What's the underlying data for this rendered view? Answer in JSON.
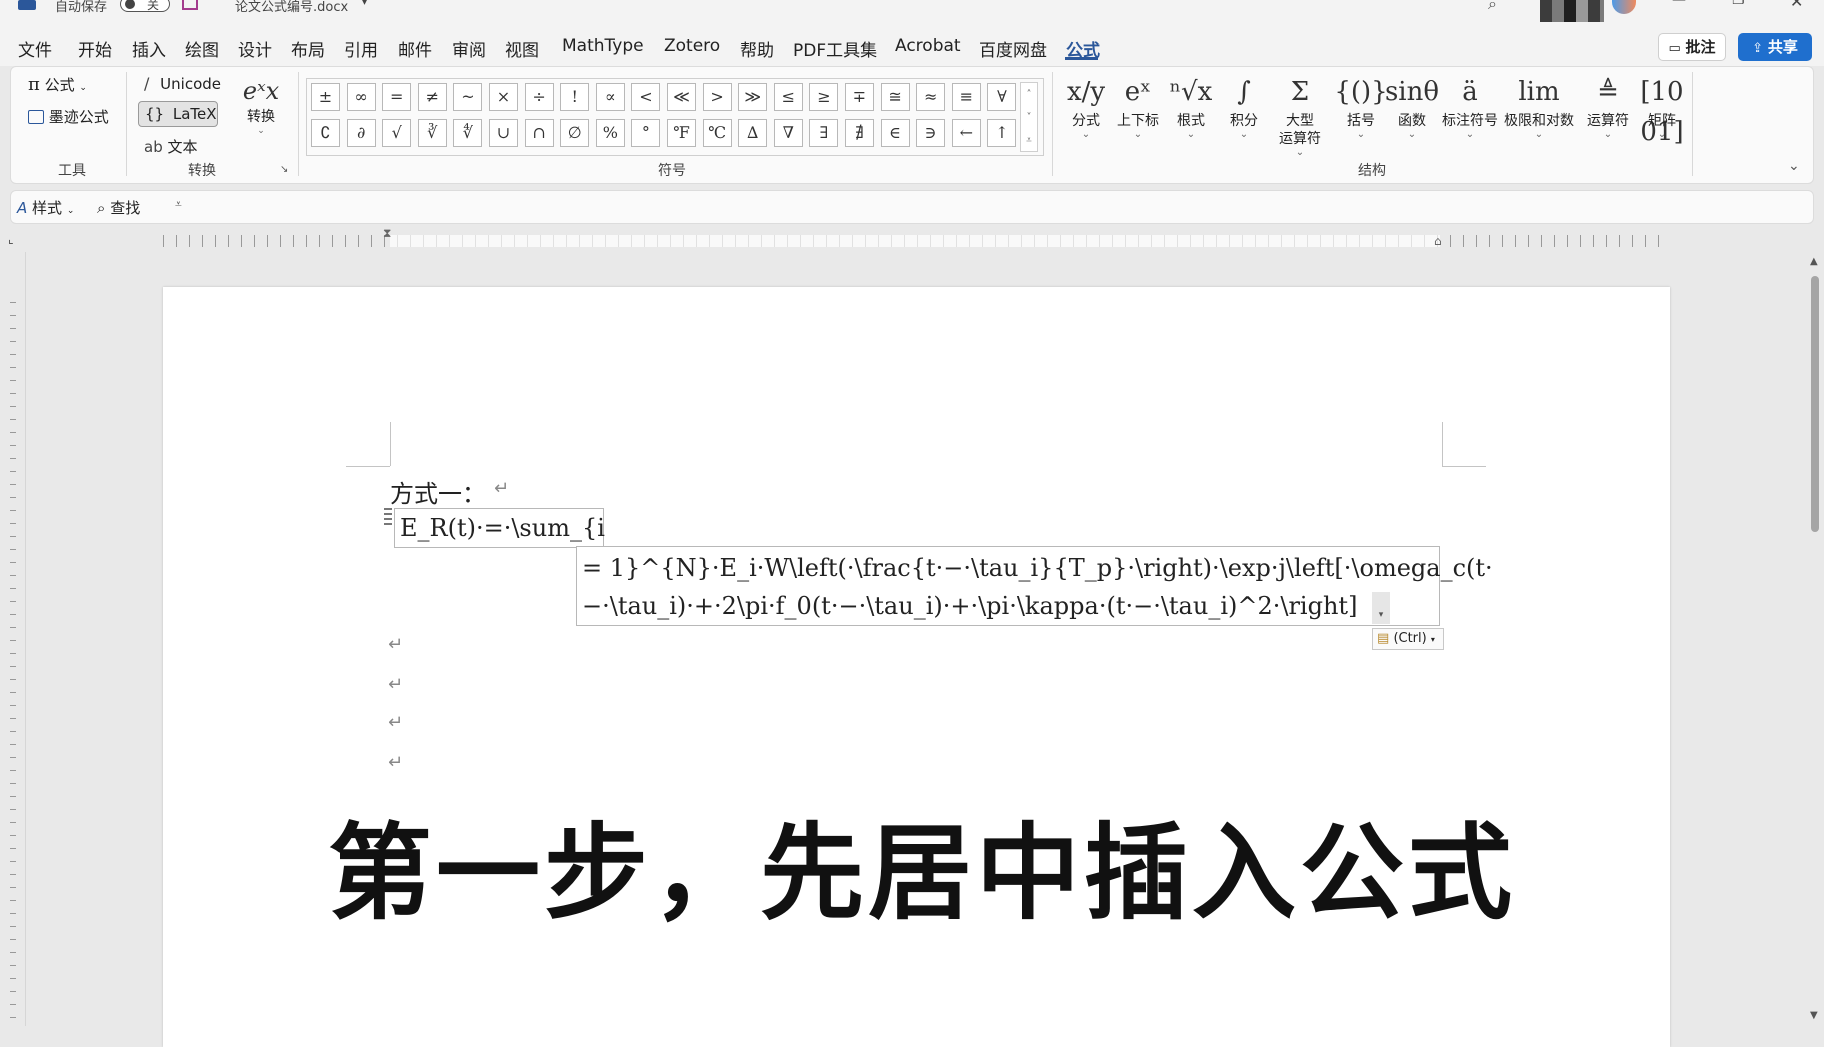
{
  "titlebar": {
    "autosave_label": "自动保存",
    "autosave_state": "关",
    "doc_title": "论文公式编号.docx"
  },
  "menu": {
    "items": [
      "文件",
      "开始",
      "插入",
      "绘图",
      "设计",
      "布局",
      "引用",
      "邮件",
      "审阅",
      "视图",
      "MathType",
      "Zotero",
      "帮助",
      "PDF工具集",
      "Acrobat",
      "百度网盘",
      "公式"
    ],
    "active": "公式",
    "comment_label": "批注",
    "share_label": "共享"
  },
  "ribbon": {
    "tools": {
      "equation_label": "公式",
      "ink_label": "墨迹公式",
      "group_label": "工具"
    },
    "convert": {
      "unicode_label": "Unicode",
      "latex_label": "LaTeX",
      "text_label": "文本",
      "convert_label": "转换",
      "group_label": "转换"
    },
    "symbols": {
      "row1": [
        "±",
        "∞",
        "=",
        "≠",
        "~",
        "×",
        "÷",
        "!",
        "∝",
        "<",
        "≪",
        ">",
        "≫",
        "≤",
        "≥",
        "∓",
        "≅",
        "≈",
        "≡",
        "∀"
      ],
      "row2": [
        "∁",
        "∂",
        "√",
        "∛",
        "∜",
        "∪",
        "∩",
        "∅",
        "%",
        "°",
        "℉",
        "℃",
        "∆",
        "∇",
        "∃",
        "∄",
        "∈",
        "∋",
        "←",
        "↑"
      ],
      "group_label": "符号"
    },
    "structures": {
      "items": [
        {
          "label": "分式",
          "glyph": "x/y"
        },
        {
          "label": "上下标",
          "glyph": "eˣ"
        },
        {
          "label": "根式",
          "glyph": "ⁿ√x"
        },
        {
          "label": "积分",
          "glyph": "∫"
        },
        {
          "label": "大型\n运算符",
          "glyph": "Σ"
        },
        {
          "label": "括号",
          "glyph": "{()}"
        },
        {
          "label": "函数",
          "glyph": "sinθ"
        },
        {
          "label": "标注符号",
          "glyph": "ä"
        },
        {
          "label": "极限和对数",
          "glyph": "lim"
        },
        {
          "label": "运算符",
          "glyph": "≜"
        },
        {
          "label": "矩阵",
          "glyph": "[10 01]"
        }
      ],
      "group_label": "结构"
    }
  },
  "qat": {
    "style_label": "样式",
    "find_label": "查找"
  },
  "document": {
    "heading": "方式一：",
    "formula_line1": "E_R(t)·=·\\sum_{i",
    "formula_line2": "= 1}^{N}·E_i·W\\left(·\\frac{t·−·\\tau_i}{T_p}·\\right)·\\exp·j\\left[·\\omega_c(t·",
    "formula_line3": "−·\\tau_i)·+·2\\pi·f_0(t·−·\\tau_i)·+·\\pi·\\kappa·(t·−·\\tau_i)^2·\\right]",
    "paste_options": "(Ctrl)",
    "paragraph_mark": "↵",
    "caption": "第一步，先居中插入公式"
  }
}
